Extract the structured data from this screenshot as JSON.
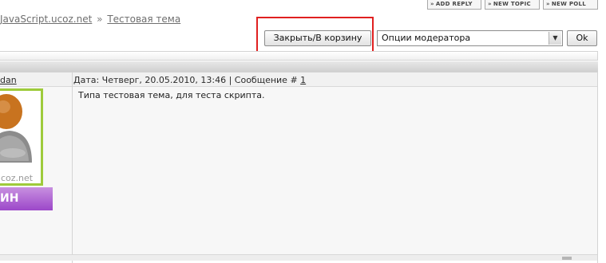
{
  "top_buttons": {
    "add_reply": "ADD REPLY",
    "new_topic": "NEW TOPIC",
    "new_poll": "NEW POLL"
  },
  "breadcrumb": {
    "site": "JavaScript.ucoz.net",
    "separator": "»",
    "topic": "Тестовая тема"
  },
  "moderation": {
    "close_trash_label": "Закрыть/В корзину",
    "select_value": "Опции модератора",
    "ok_label": "Ok"
  },
  "post": {
    "author": "dan",
    "meta_prefix": "Дата: Четверг, 20.05.2010, 13:46 | Сообщение #",
    "message_number": "1",
    "text": "Типа тестовая тема, для теста скрипта.",
    "avatar_watermark": "ucoz.net",
    "rank": "ИН"
  },
  "colors": {
    "highlight": "#e02020",
    "avatar_border": "#9ecb3b",
    "rank_badge": "#9c47c9"
  }
}
